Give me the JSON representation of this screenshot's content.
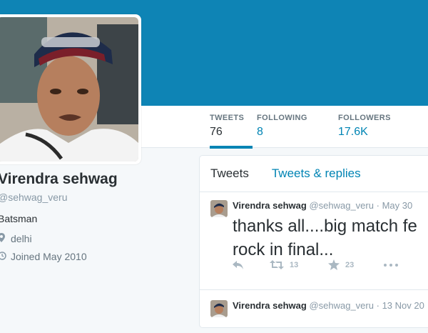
{
  "colors": {
    "banner": "#0e84b5",
    "link": "#0084b4",
    "text": "#292f33",
    "muted": "#8899a6"
  },
  "profile": {
    "name": "Virendra sehwag",
    "handle": "@sehwag_veru",
    "bio": "Batsman",
    "location": "delhi",
    "joined": "Joined May 2010",
    "location_icon": "location-pin-icon",
    "joined_icon": "calendar-icon"
  },
  "stats": [
    {
      "label": "TWEETS",
      "value": "76"
    },
    {
      "label": "FOLLOWING",
      "value": "8"
    },
    {
      "label": "FOLLOWERS",
      "value": "17.6K"
    }
  ],
  "timeline": {
    "tabs": [
      "Tweets",
      "Tweets & replies"
    ],
    "tweets": [
      {
        "name": "Virendra sehwag",
        "handle": "@sehwag_veru",
        "sep": "·",
        "date": "May 30",
        "text_line1": "thanks all....big match fe",
        "text_line2": "rock in final...",
        "retweets": "13",
        "favorites": "23"
      },
      {
        "name": "Virendra sehwag",
        "handle": "@sehwag_veru",
        "sep": "·",
        "date": "13 Nov 20"
      }
    ]
  }
}
